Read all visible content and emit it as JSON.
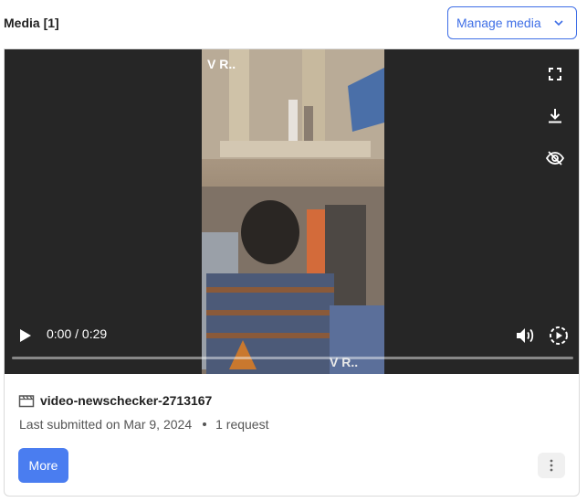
{
  "header": {
    "title": "Media [1]",
    "manage_label": "Manage media"
  },
  "player": {
    "current_time": "0:00",
    "separator": " / ",
    "duration": "0:29",
    "progress_fraction": 0,
    "watermark_top": "V R..",
    "watermark_bottom": "V R.."
  },
  "item": {
    "filename": "video-newschecker-2713167",
    "submitted": "Last submitted on Mar 9, 2024",
    "requests": "1 request",
    "more_label": "More"
  },
  "icons": [
    "chevron-down-icon",
    "fullscreen-icon",
    "download-icon",
    "hide-icon",
    "play-icon",
    "volume-icon",
    "playback-speed-icon",
    "video-file-icon",
    "kebab-icon"
  ],
  "colors": {
    "accent": "#3f6fe6",
    "primary_button": "#4a7df0",
    "player_bg": "#262626"
  }
}
